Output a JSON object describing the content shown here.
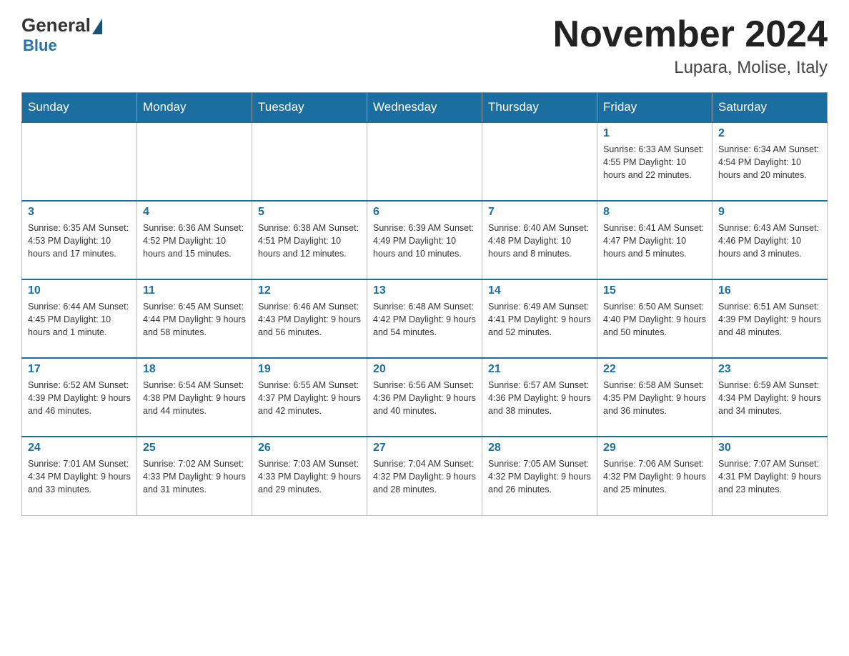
{
  "logo": {
    "general": "General",
    "blue": "Blue"
  },
  "title": "November 2024",
  "location": "Lupara, Molise, Italy",
  "days_of_week": [
    "Sunday",
    "Monday",
    "Tuesday",
    "Wednesday",
    "Thursday",
    "Friday",
    "Saturday"
  ],
  "weeks": [
    [
      {
        "day": "",
        "info": ""
      },
      {
        "day": "",
        "info": ""
      },
      {
        "day": "",
        "info": ""
      },
      {
        "day": "",
        "info": ""
      },
      {
        "day": "",
        "info": ""
      },
      {
        "day": "1",
        "info": "Sunrise: 6:33 AM\nSunset: 4:55 PM\nDaylight: 10 hours\nand 22 minutes."
      },
      {
        "day": "2",
        "info": "Sunrise: 6:34 AM\nSunset: 4:54 PM\nDaylight: 10 hours\nand 20 minutes."
      }
    ],
    [
      {
        "day": "3",
        "info": "Sunrise: 6:35 AM\nSunset: 4:53 PM\nDaylight: 10 hours\nand 17 minutes."
      },
      {
        "day": "4",
        "info": "Sunrise: 6:36 AM\nSunset: 4:52 PM\nDaylight: 10 hours\nand 15 minutes."
      },
      {
        "day": "5",
        "info": "Sunrise: 6:38 AM\nSunset: 4:51 PM\nDaylight: 10 hours\nand 12 minutes."
      },
      {
        "day": "6",
        "info": "Sunrise: 6:39 AM\nSunset: 4:49 PM\nDaylight: 10 hours\nand 10 minutes."
      },
      {
        "day": "7",
        "info": "Sunrise: 6:40 AM\nSunset: 4:48 PM\nDaylight: 10 hours\nand 8 minutes."
      },
      {
        "day": "8",
        "info": "Sunrise: 6:41 AM\nSunset: 4:47 PM\nDaylight: 10 hours\nand 5 minutes."
      },
      {
        "day": "9",
        "info": "Sunrise: 6:43 AM\nSunset: 4:46 PM\nDaylight: 10 hours\nand 3 minutes."
      }
    ],
    [
      {
        "day": "10",
        "info": "Sunrise: 6:44 AM\nSunset: 4:45 PM\nDaylight: 10 hours\nand 1 minute."
      },
      {
        "day": "11",
        "info": "Sunrise: 6:45 AM\nSunset: 4:44 PM\nDaylight: 9 hours\nand 58 minutes."
      },
      {
        "day": "12",
        "info": "Sunrise: 6:46 AM\nSunset: 4:43 PM\nDaylight: 9 hours\nand 56 minutes."
      },
      {
        "day": "13",
        "info": "Sunrise: 6:48 AM\nSunset: 4:42 PM\nDaylight: 9 hours\nand 54 minutes."
      },
      {
        "day": "14",
        "info": "Sunrise: 6:49 AM\nSunset: 4:41 PM\nDaylight: 9 hours\nand 52 minutes."
      },
      {
        "day": "15",
        "info": "Sunrise: 6:50 AM\nSunset: 4:40 PM\nDaylight: 9 hours\nand 50 minutes."
      },
      {
        "day": "16",
        "info": "Sunrise: 6:51 AM\nSunset: 4:39 PM\nDaylight: 9 hours\nand 48 minutes."
      }
    ],
    [
      {
        "day": "17",
        "info": "Sunrise: 6:52 AM\nSunset: 4:39 PM\nDaylight: 9 hours\nand 46 minutes."
      },
      {
        "day": "18",
        "info": "Sunrise: 6:54 AM\nSunset: 4:38 PM\nDaylight: 9 hours\nand 44 minutes."
      },
      {
        "day": "19",
        "info": "Sunrise: 6:55 AM\nSunset: 4:37 PM\nDaylight: 9 hours\nand 42 minutes."
      },
      {
        "day": "20",
        "info": "Sunrise: 6:56 AM\nSunset: 4:36 PM\nDaylight: 9 hours\nand 40 minutes."
      },
      {
        "day": "21",
        "info": "Sunrise: 6:57 AM\nSunset: 4:36 PM\nDaylight: 9 hours\nand 38 minutes."
      },
      {
        "day": "22",
        "info": "Sunrise: 6:58 AM\nSunset: 4:35 PM\nDaylight: 9 hours\nand 36 minutes."
      },
      {
        "day": "23",
        "info": "Sunrise: 6:59 AM\nSunset: 4:34 PM\nDaylight: 9 hours\nand 34 minutes."
      }
    ],
    [
      {
        "day": "24",
        "info": "Sunrise: 7:01 AM\nSunset: 4:34 PM\nDaylight: 9 hours\nand 33 minutes."
      },
      {
        "day": "25",
        "info": "Sunrise: 7:02 AM\nSunset: 4:33 PM\nDaylight: 9 hours\nand 31 minutes."
      },
      {
        "day": "26",
        "info": "Sunrise: 7:03 AM\nSunset: 4:33 PM\nDaylight: 9 hours\nand 29 minutes."
      },
      {
        "day": "27",
        "info": "Sunrise: 7:04 AM\nSunset: 4:32 PM\nDaylight: 9 hours\nand 28 minutes."
      },
      {
        "day": "28",
        "info": "Sunrise: 7:05 AM\nSunset: 4:32 PM\nDaylight: 9 hours\nand 26 minutes."
      },
      {
        "day": "29",
        "info": "Sunrise: 7:06 AM\nSunset: 4:32 PM\nDaylight: 9 hours\nand 25 minutes."
      },
      {
        "day": "30",
        "info": "Sunrise: 7:07 AM\nSunset: 4:31 PM\nDaylight: 9 hours\nand 23 minutes."
      }
    ]
  ]
}
